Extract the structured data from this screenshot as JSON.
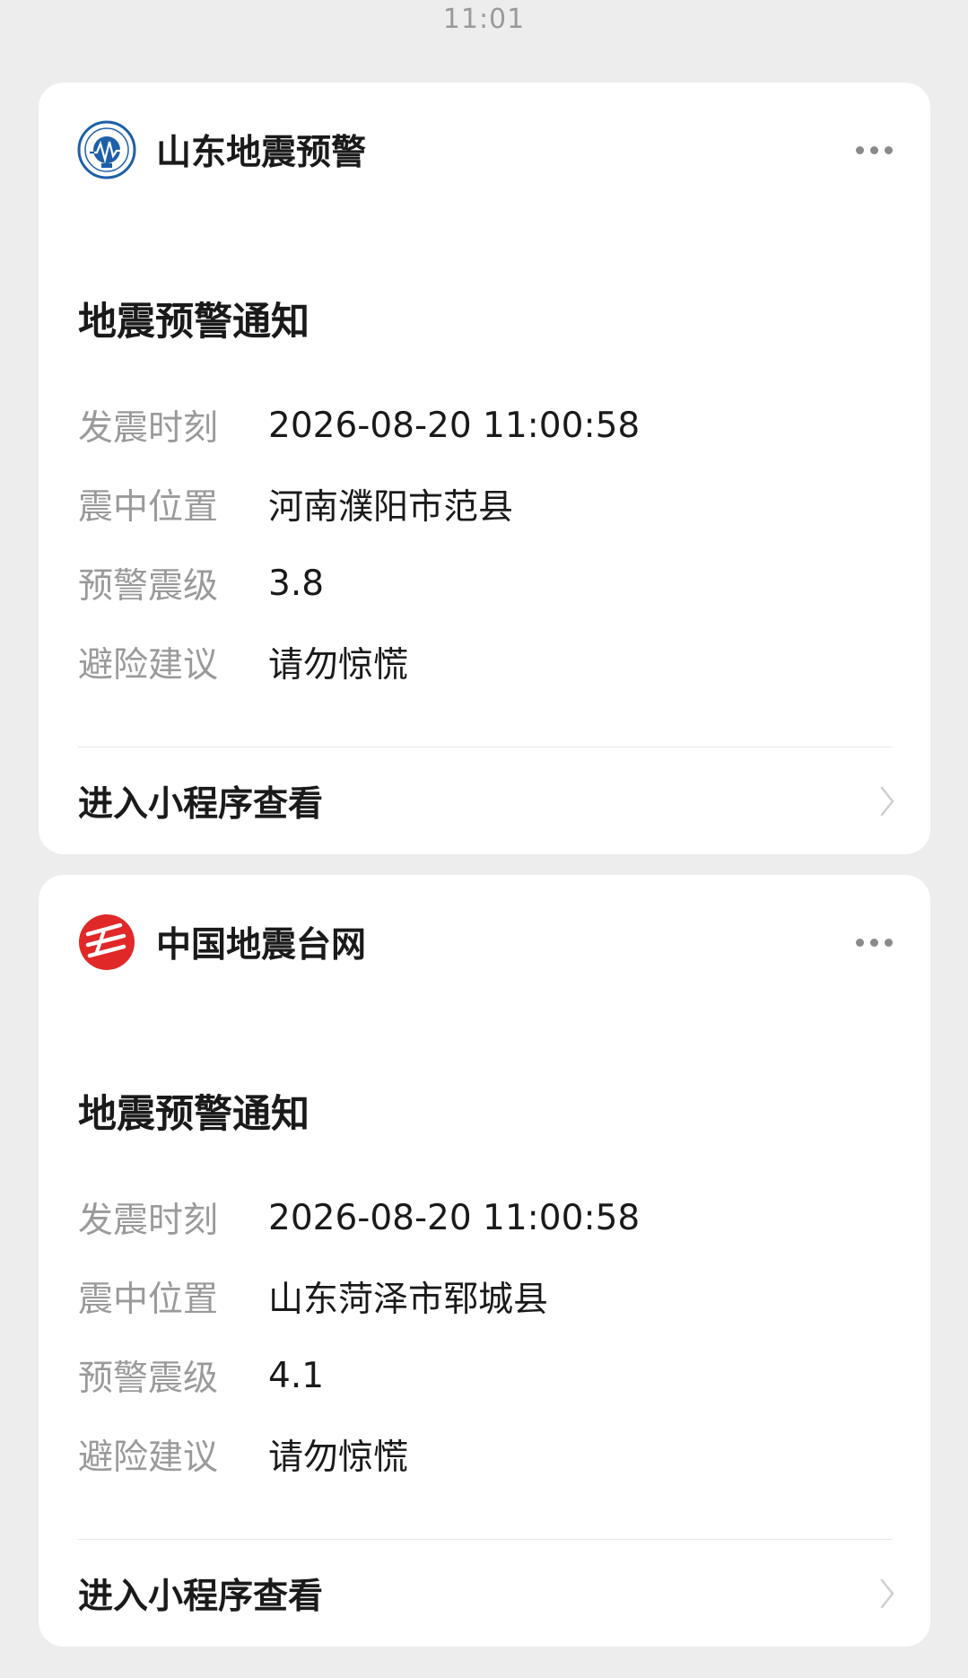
{
  "status_bar": {
    "time": "11:01"
  },
  "cards": [
    {
      "account_name": "山东地震预警",
      "logo_icon": "shandong-earthquake-logo-icon",
      "notice_title": "地震预警通知",
      "fields": [
        {
          "label": "发震时刻",
          "value": "2026-08-20 11:00:58"
        },
        {
          "label": "震中位置",
          "value": "河南濮阳市范县"
        },
        {
          "label": "预警震级",
          "value": "3.8"
        },
        {
          "label": "避险建议",
          "value": "请勿惊慌"
        }
      ],
      "footer_label": "进入小程序查看"
    },
    {
      "account_name": "中国地震台网",
      "logo_icon": "china-earthquake-networks-logo-icon",
      "notice_title": "地震预警通知",
      "fields": [
        {
          "label": "发震时刻",
          "value": "2026-08-20 11:00:58"
        },
        {
          "label": "震中位置",
          "value": "山东菏泽市郓城县"
        },
        {
          "label": "预警震级",
          "value": "4.1"
        },
        {
          "label": "避险建议",
          "value": "请勿惊慌"
        }
      ],
      "footer_label": "进入小程序查看"
    }
  ],
  "colors": {
    "background": "#ededed",
    "card": "#ffffff",
    "label_gray": "#9a9a9a",
    "text_dark": "#1a1a1a",
    "logo_blue": "#1d5fa8",
    "logo_red": "#e02828"
  }
}
